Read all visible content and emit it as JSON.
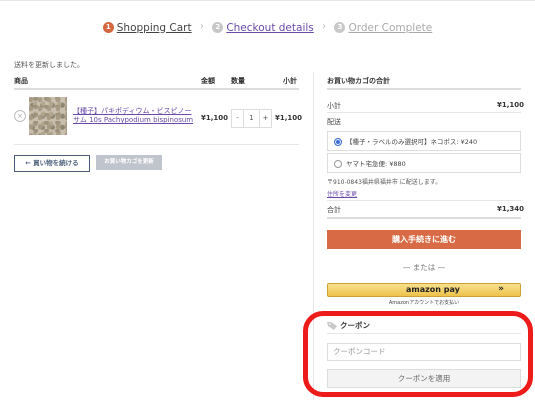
{
  "steps": [
    {
      "num": "1",
      "label": "Shopping Cart"
    },
    {
      "num": "2",
      "label": "Checkout details"
    },
    {
      "num": "3",
      "label": "Order Complete"
    }
  ],
  "step_separator": "›",
  "notice": "送料を更新しました。",
  "cart": {
    "headers": {
      "product": "商品",
      "price": "金額",
      "quantity": "数量",
      "subtotal": "小計"
    },
    "item": {
      "remove": "×",
      "name": "【種子】パキポディウム・ビスピノーサム 10s Pachypodium bispinosum",
      "price": "¥1,100",
      "qty_minus": "-",
      "qty": "1",
      "qty_plus": "+",
      "subtotal": "¥1,100"
    },
    "continue_button": "← 買い物を続ける",
    "update_button": "お買い物カゴを更新"
  },
  "totals": {
    "title": "お買い物カゴの合計",
    "subtotal_label": "小計",
    "subtotal_value": "¥1,100",
    "shipping_label": "配送",
    "shipping_options": [
      {
        "label": "【種子・ラベルのみ選択可】ネコポス: ¥240",
        "selected": true
      },
      {
        "label": "ヤマト宅急便: ¥880",
        "selected": false
      }
    ],
    "ship_to": "〒910-0843福井県福井市 に配送します。",
    "change_address": "住所を変更",
    "total_label": "合計",
    "total_value": "¥1,340",
    "checkout_button": "購入手続きに進む",
    "or_text": "— または —",
    "amazon": {
      "logo": "amazon pay",
      "arrow": "»",
      "caption": "Amazonアカウントでお支払い"
    }
  },
  "coupon": {
    "title": "クーポン",
    "placeholder": "クーポンコード",
    "apply_button": "クーポンを適用"
  },
  "colors": {
    "accent": "#d86b45",
    "link": "#6a4aa8",
    "annotation": "#ee1b1b"
  }
}
